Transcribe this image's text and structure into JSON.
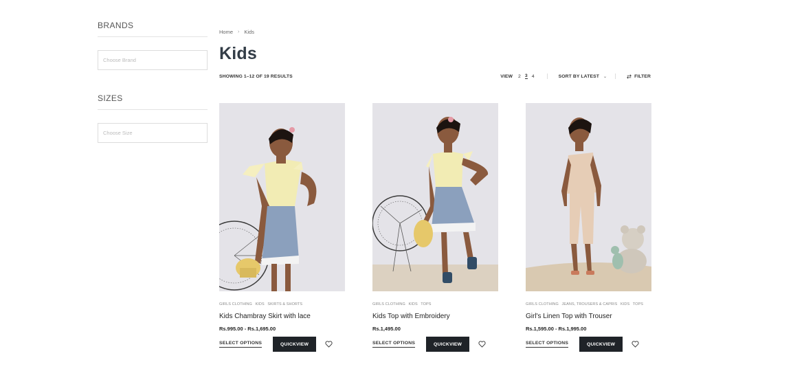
{
  "sidebar": {
    "brands": {
      "title": "BRANDS",
      "placeholder": "Choose Brand"
    },
    "sizes": {
      "title": "SIZES",
      "placeholder": "Choose Size"
    }
  },
  "breadcrumb": {
    "home": "Home",
    "separator": "›",
    "current": "Kids"
  },
  "page_title": "Kids",
  "toolbar": {
    "results_text": "SHOWING 1–12 OF 19 RESULTS",
    "view_label": "VIEW",
    "view_options": [
      "2",
      "3",
      "4"
    ],
    "view_active": "3",
    "sort_label": "SORT BY LATEST",
    "filter_label": "FILTER"
  },
  "products": [
    {
      "categories": [
        "GIRLS CLOTHING",
        "KIDS",
        "SKIRTS & SHORTS"
      ],
      "title": "Kids Chambray Skirt with lace",
      "price": "Rs.995.00 - Rs.1,695.00",
      "select_label": "SELECT OPTIONS",
      "quickview_label": "QUICKVIEW"
    },
    {
      "categories": [
        "GIRLS CLOTHING",
        "KIDS",
        "TOPS"
      ],
      "title": "Kids Top with Embroidery",
      "price": "Rs.1,495.00",
      "select_label": "SELECT OPTIONS",
      "quickview_label": "QUICKVIEW"
    },
    {
      "categories": [
        "GIRLS CLOTHING",
        "JEANS, TROUSERS & CAPRIS",
        "KIDS",
        "TOPS"
      ],
      "title": "Girl's Linen Top with Trouser",
      "price": "Rs.1,595.00 - Rs.1,995.00",
      "select_label": "SELECT OPTIONS",
      "quickview_label": "QUICKVIEW"
    }
  ],
  "colors": {
    "title": "#333d47",
    "button_dark": "#1f2328",
    "photo_bg": "#e4e3e8",
    "top_yellow": "#f2ecb4",
    "denim": "#8ba0bd",
    "linen": "#e6cdb6"
  }
}
